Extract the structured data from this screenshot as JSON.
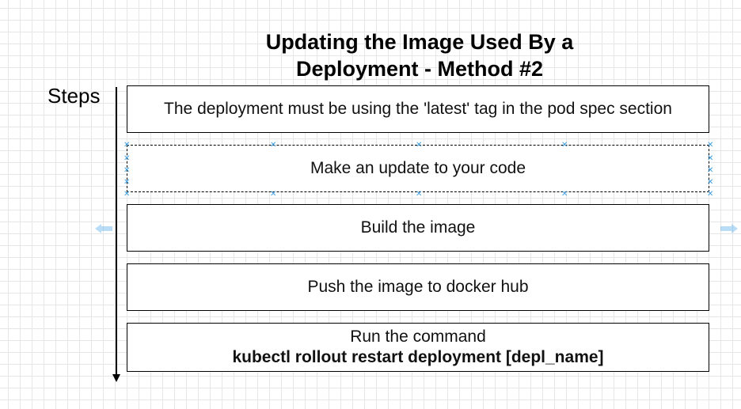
{
  "title": {
    "line1": "Updating the Image Used By a",
    "line2": "Deployment - Method #2"
  },
  "steps_label": "Steps",
  "steps": [
    {
      "text": "The deployment must be using the 'latest' tag in the pod spec section"
    },
    {
      "text": "Make an update to your code"
    },
    {
      "text": "Build the image"
    },
    {
      "text": "Push the image to docker hub"
    },
    {
      "text": "Run the command",
      "command": "kubectl rollout restart deployment [depl_name]"
    }
  ],
  "colors": {
    "grid": "#e6e6e6",
    "selection_handle": "#39a0e6",
    "border": "#000000"
  },
  "icons": {
    "selection_handles": "x-marker",
    "side_hints": "double-arrow-icon"
  }
}
